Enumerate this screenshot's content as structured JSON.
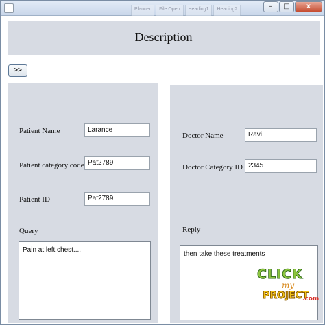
{
  "window": {
    "background_tabs": [
      "Planner",
      "File Open",
      "Heading1",
      "Heading2"
    ],
    "minimize_glyph": "–",
    "maximize_glyph": "□",
    "close_glyph": "x"
  },
  "header": {
    "title": "Description"
  },
  "nav": {
    "next_label": ">>"
  },
  "patient": {
    "name_label": "Patient Name",
    "name_value": "Larance",
    "category_label": "Patient category code",
    "category_value": "Pat2789",
    "id_label": "Patient ID",
    "id_value": "Pat2789",
    "query_label": "Query",
    "query_value": "Pain at left chest...."
  },
  "doctor": {
    "name_label": "Doctor Name",
    "name_value": "Ravi",
    "category_label": "Doctor Category ID",
    "category_value": "2345",
    "reply_label": "Reply",
    "reply_value": "then take these treatments"
  },
  "watermark": {
    "line1": "CLICK",
    "line2": "my",
    "line3": "PROJECT",
    "line4": ".com"
  },
  "colors": {
    "panel": "#d7dbe3",
    "titlebar": "#c9d7ea",
    "close": "#c54b2f"
  }
}
